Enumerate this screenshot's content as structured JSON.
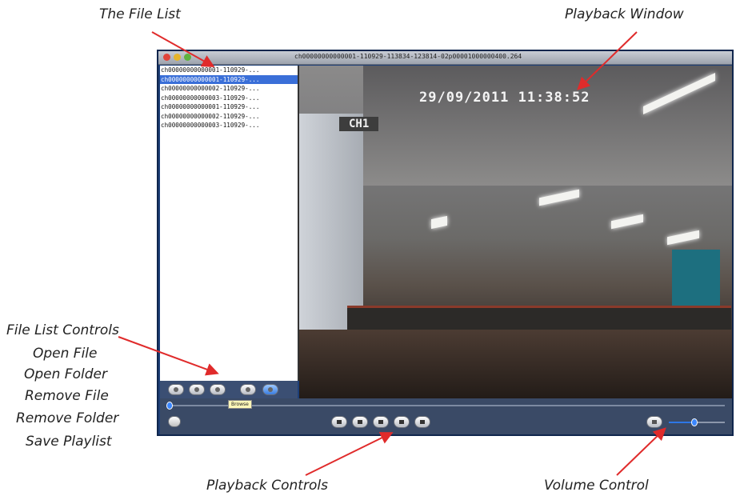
{
  "annotations": {
    "file_list": "The File List",
    "playback_window": "Playback Window",
    "file_list_controls": [
      "File List Controls",
      "Open File",
      "Open Folder",
      "Remove File",
      "Remove Folder",
      "Save Playlist"
    ],
    "playback_controls": "Playback Controls",
    "volume_control": "Volume Control"
  },
  "window": {
    "title": "ch00000000000001-110929-113834-123814-02p00001000000400.264"
  },
  "files": [
    "ch00000000000001-110929-...",
    "ch00000000000001-110929-...",
    "ch00000000000002-110929-...",
    "ch00000000000003-110929-...",
    "ch00000000000001-110929-...",
    "ch00000000000002-110929-...",
    "ch00000000000003-110929-..."
  ],
  "selected_file_index": 1,
  "video": {
    "timestamp": "29/09/2011  11:38:52",
    "channel": "CH1"
  },
  "tooltip": "Browse",
  "playback": {
    "progress_fraction": 0.0,
    "volume_fraction": 0.45
  },
  "icons": {
    "close": "close-icon",
    "minimize": "minimize-icon",
    "zoom": "zoom-icon",
    "open_file": "open-file-icon",
    "open_folder": "open-folder-icon",
    "remove_file": "remove-file-icon",
    "remove_folder": "remove-folder-icon",
    "save_playlist": "save-playlist-icon",
    "play": "play-icon",
    "stop": "stop-icon",
    "rewind": "rewind-icon",
    "step": "step-icon",
    "forward": "fast-forward-icon",
    "mute": "speaker-icon"
  },
  "colors": {
    "selection": "#3a6fd8",
    "window_frame": "#1d3f78",
    "arrow": "#e02b2b"
  }
}
